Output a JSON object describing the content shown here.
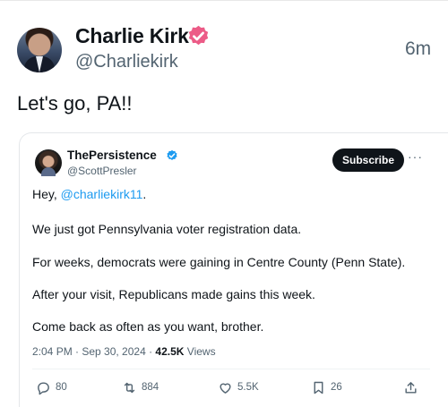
{
  "post": {
    "author_name": "Charlie Kirk",
    "author_handle": "@Charliekirk",
    "time_ago": "6m",
    "text": "Let's go, PA!!"
  },
  "quoted": {
    "author_name": "ThePersistence",
    "author_handle": "@ScottPresler",
    "subscribe_label": "Subscribe",
    "more_label": "···",
    "greeting": "Hey, ",
    "mention": "@charliekirk11",
    "greeting_end": ".",
    "lines": [
      "We just got Pennsylvania voter registration data.",
      "For weeks, democrats were gaining in Centre County (Penn State).",
      "After your visit, Republicans made gains this week.",
      "Come back as often as you want, brother."
    ],
    "timestamp": "2:04 PM · Sep 30, 2024 · ",
    "views_count": "42.5K",
    "views_label": " Views",
    "actions": {
      "replies": "80",
      "reposts": "884",
      "likes": "5.5K",
      "bookmarks": "26"
    }
  },
  "colors": {
    "verified": "#ec5b87",
    "verified_inner": "#1d9bf0",
    "mention": "#1d9bf0",
    "repost": "#1d9b5e"
  },
  "icons": [
    "verified-badge-icon",
    "more-icon",
    "reply-icon",
    "repost-icon",
    "like-icon",
    "bookmark-icon",
    "share-icon"
  ]
}
